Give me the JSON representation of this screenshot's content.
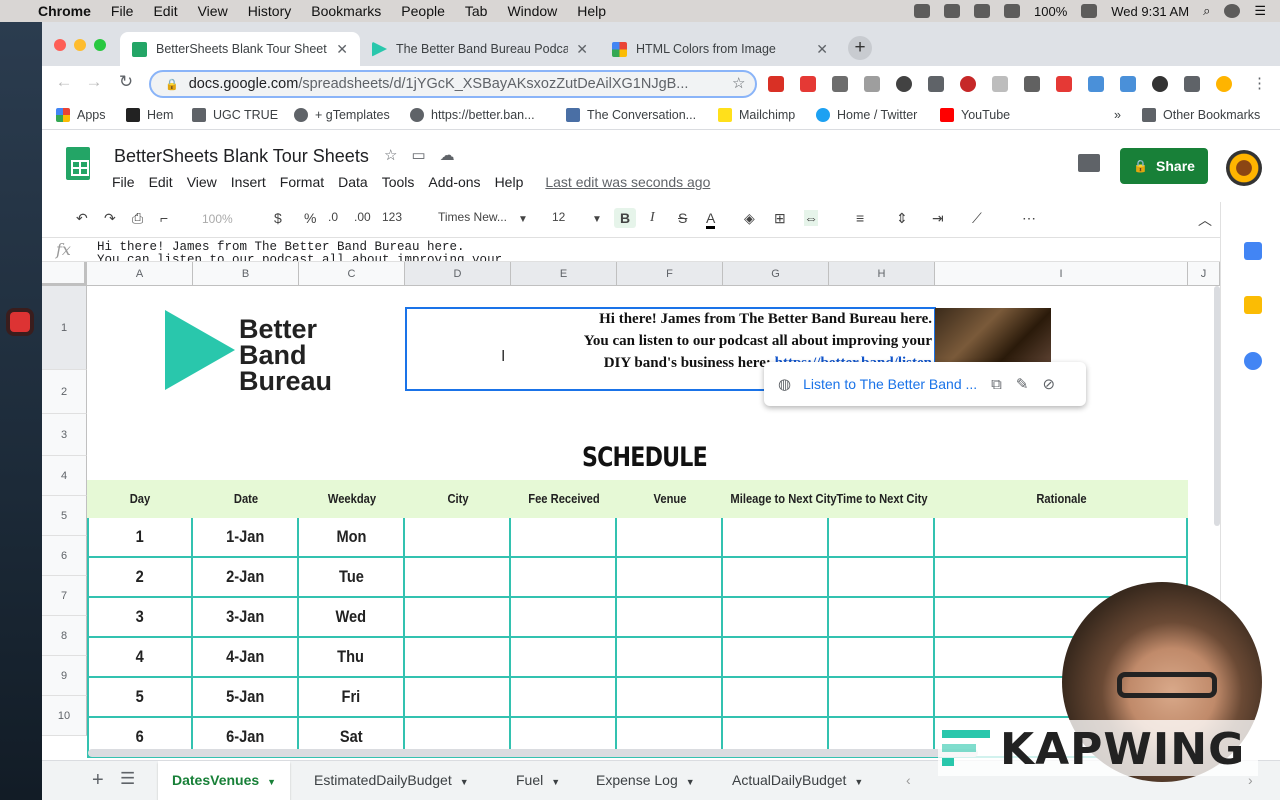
{
  "menubar": {
    "app": "Chrome",
    "items": [
      "File",
      "Edit",
      "View",
      "History",
      "Bookmarks",
      "People",
      "Tab",
      "Window",
      "Help"
    ],
    "battery": "100%",
    "clock": "Wed 9:31 AM"
  },
  "tabs": [
    {
      "label": "BetterSheets Blank Tour Sheet",
      "color": "#23a566"
    },
    {
      "label": "The Better Band Bureau Podca",
      "color": "#29c7ac"
    },
    {
      "label": "HTML Colors from Image",
      "color": "#ea4335"
    }
  ],
  "omnibox": {
    "host": "docs.google.com",
    "path": "/spreadsheets/d/1jYGcK_XSBayAKsxozZutDeAilXG1NJgB..."
  },
  "bookmarks": [
    {
      "label": "Apps"
    },
    {
      "label": "Hem"
    },
    {
      "label": "UGC TRUE"
    },
    {
      "label": "+ gTemplates"
    },
    {
      "label": "https://better.ban..."
    },
    {
      "label": "The Conversation..."
    },
    {
      "label": "Mailchimp"
    },
    {
      "label": "Home / Twitter"
    },
    {
      "label": "YouTube"
    }
  ],
  "bookmarks_more": "»",
  "bookmarks_other": "Other Bookmarks",
  "doc": {
    "title": "BetterSheets Blank Tour Sheets",
    "menu": [
      "File",
      "Edit",
      "View",
      "Insert",
      "Format",
      "Data",
      "Tools",
      "Add-ons",
      "Help"
    ],
    "last_edit": "Last edit was seconds ago",
    "share": "Share"
  },
  "toolbar": {
    "zoom": "100%",
    "currency": "$",
    "percent": "%",
    "dec_less": ".0",
    "dec_more": ".00",
    "format": "123",
    "font": "Times New...",
    "size": "12",
    "bold": "B",
    "italic": "I",
    "strike": "S",
    "text_color": "A"
  },
  "formula": {
    "fx": "fx",
    "text": "Hi there! James from The Better Band Bureau here.\nYou can listen to our podcast all about improving your"
  },
  "columns": [
    "A",
    "B",
    "C",
    "D",
    "E",
    "F",
    "G",
    "H",
    "I",
    "J"
  ],
  "rows": [
    "1",
    "2",
    "3",
    "4",
    "5",
    "6",
    "7",
    "8",
    "9",
    "10"
  ],
  "logo_text": [
    "Better",
    "Band",
    "Bureau"
  ],
  "message": {
    "line1": "Hi there! James from The Better Band Bureau here.",
    "line2": "You can listen to our podcast all about improving your",
    "line3": "DIY band's business here: ",
    "link": "https://better.band/listen"
  },
  "link_popup": "Listen to The Better Band ...",
  "schedule_title": "SCHEDULE",
  "table": {
    "headers": [
      "Day",
      "Date",
      "Weekday",
      "City",
      "Fee Received",
      "Venue",
      "Mileage to Next City",
      "Time to Next City",
      "Rationale"
    ],
    "rows": [
      [
        "1",
        "1-Jan",
        "Mon"
      ],
      [
        "2",
        "2-Jan",
        "Tue"
      ],
      [
        "3",
        "3-Jan",
        "Wed"
      ],
      [
        "4",
        "4-Jan",
        "Thu"
      ],
      [
        "5",
        "5-Jan",
        "Fri"
      ],
      [
        "6",
        "6-Jan",
        "Sat"
      ]
    ]
  },
  "sheet_tabs": [
    {
      "label": "DatesVenues",
      "active": true
    },
    {
      "label": "EstimatedDailyBudget"
    },
    {
      "label": "Fuel"
    },
    {
      "label": "Expense Log"
    },
    {
      "label": "ActualDailyBudget"
    }
  ],
  "watermark": "KAPWING",
  "colors": {
    "accent_teal": "#33c2b0",
    "header_band": "#e6f9d6",
    "sheets_green": "#188038",
    "link_blue": "#1155cc"
  }
}
